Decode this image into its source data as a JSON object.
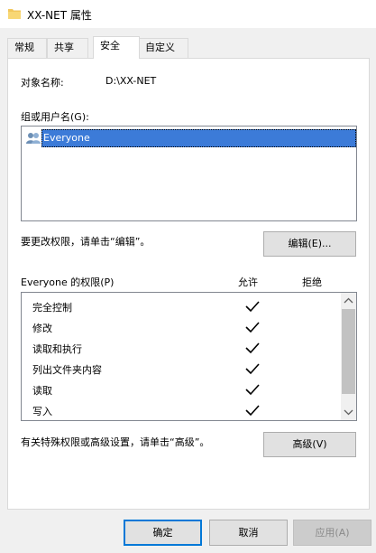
{
  "window": {
    "title": "XX-NET 属性"
  },
  "tabs": [
    {
      "label": "常规"
    },
    {
      "label": "共享"
    },
    {
      "label": "安全"
    },
    {
      "label": "自定义"
    }
  ],
  "object": {
    "label": "对象名称:",
    "value": "D:\\XX-NET"
  },
  "groups": {
    "label": "组或用户名(G):",
    "items": [
      {
        "name": "Everyone",
        "icon": "users-icon",
        "selected": true
      }
    ]
  },
  "edit": {
    "hint": "要更改权限，请单击“编辑”。",
    "button_label": "编辑(E)..."
  },
  "permissions": {
    "title": "Everyone 的权限(P)",
    "allow_header": "允许",
    "deny_header": "拒绝",
    "rows": [
      {
        "name": "完全控制",
        "allow": true,
        "deny": false
      },
      {
        "name": "修改",
        "allow": true,
        "deny": false
      },
      {
        "name": "读取和执行",
        "allow": true,
        "deny": false
      },
      {
        "name": "列出文件夹内容",
        "allow": true,
        "deny": false
      },
      {
        "name": "读取",
        "allow": true,
        "deny": false
      },
      {
        "name": "写入",
        "allow": true,
        "deny": false
      }
    ]
  },
  "advanced": {
    "hint": "有关特殊权限或高级设置，请单击“高级”。",
    "button_label": "高级(V)"
  },
  "footer": {
    "ok_label": "确定",
    "cancel_label": "取消",
    "apply_label": "应用(A)"
  },
  "colors": {
    "selection": "#3c7bd8",
    "accent": "#0078d7",
    "folder": "#f2c75c"
  }
}
